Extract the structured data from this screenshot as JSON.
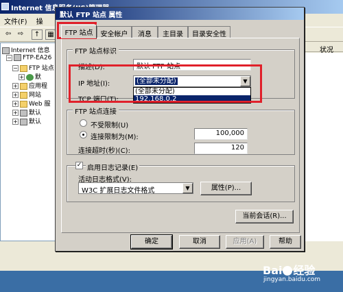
{
  "iis": {
    "title": "Internet 信息服务(IIS)管理器",
    "menu": [
      "文件(F)",
      "操"
    ],
    "tree": [
      {
        "label": "Internet 信息",
        "pm": "",
        "icon": "pc"
      },
      {
        "label": "FTP-EA26",
        "pm": "−",
        "icon": "pc"
      },
      {
        "label": "FTP 站点",
        "pm": "−",
        "icon": "folder"
      },
      {
        "label": "默",
        "pm": "+",
        "icon": "globe"
      },
      {
        "label": "应用程",
        "pm": "+",
        "icon": "folder"
      },
      {
        "label": "网站",
        "pm": "+",
        "icon": "folder"
      },
      {
        "label": "Web 服",
        "pm": "+",
        "icon": "folder"
      },
      {
        "label": "默认",
        "pm": "+",
        "icon": "pc"
      },
      {
        "label": "默认",
        "pm": "+",
        "icon": "pc"
      }
    ],
    "right_header": "状况"
  },
  "dialog": {
    "title": "默认 FTP 站点 属性",
    "tabs": [
      "FTP 站点",
      "安全帐户",
      "消息",
      "主目录",
      "目录安全性"
    ],
    "identity": {
      "legend": "FTP 站点标识",
      "desc_label": "描述(D):",
      "desc_value": "默认 FTP 站点",
      "ip_label": "IP 地址(I):",
      "ip_selected": "(全部未分配)",
      "ip_options": [
        "(全部未分配)",
        "192.168.0.2"
      ],
      "port_label": "TCP 端口(T):"
    },
    "connection": {
      "legend": "FTP 站点连接",
      "unlimited_label": "不受限制(U)",
      "limited_label": "连接限制为(M):",
      "limit_value": "100,000",
      "timeout_label": "连接超时(秒)(C):",
      "timeout_value": "120"
    },
    "logging": {
      "enable_label": "启用日志记录(E)",
      "format_label": "活动日志格式(V):",
      "format_value": "W3C 扩展日志文件格式",
      "properties_button": "属性(P)..."
    },
    "current_sessions_button": "当前会话(R)...",
    "buttons": {
      "ok": "确定",
      "cancel": "取消",
      "apply": "应用(A)",
      "help": "帮助"
    }
  },
  "watermark": {
    "logo_left": "Bai",
    "logo_right": "经验",
    "url": "jingyan.baidu.com"
  },
  "colors": {
    "highlight": "#e0202a",
    "selection": "#0a246a",
    "dialog_bg": "#d4d0c8"
  }
}
